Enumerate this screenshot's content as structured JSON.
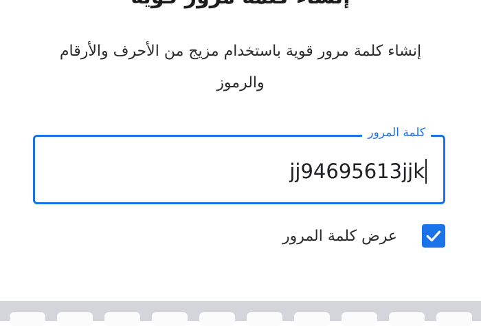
{
  "header": {
    "title": "إنشاء كلمة مرور قوية"
  },
  "description": {
    "text": "إنشاء كلمة مرور قوية باستخدام مزيج من الأحرف والأرقام والرموز"
  },
  "password_field": {
    "label": "كلمة المرور",
    "value": "jj94695613jjk",
    "focused": true
  },
  "show_password": {
    "label": "عرض كلمة المرور",
    "checked": true
  },
  "colors": {
    "accent": "#1a73e8",
    "keyboard_bg": "#d3d5da",
    "key_bg": "#fbfbfc"
  },
  "icons": {
    "checkbox": "checkmark-icon"
  }
}
